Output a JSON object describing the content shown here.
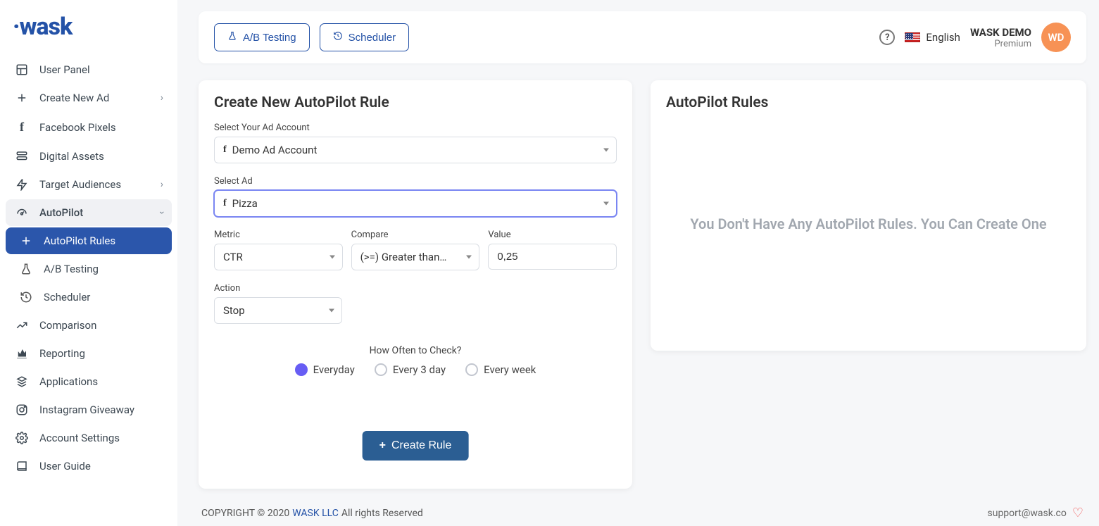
{
  "brand": "wask",
  "sidebar": {
    "items": [
      {
        "label": "User Panel"
      },
      {
        "label": "Create New Ad"
      },
      {
        "label": "Facebook Pixels"
      },
      {
        "label": "Digital Assets"
      },
      {
        "label": "Target Audiences"
      },
      {
        "label": "AutoPilot"
      },
      {
        "label": "AutoPilot Rules"
      },
      {
        "label": "A/B Testing"
      },
      {
        "label": "Scheduler"
      },
      {
        "label": "Comparison"
      },
      {
        "label": "Reporting"
      },
      {
        "label": "Applications"
      },
      {
        "label": "Instagram Giveaway"
      },
      {
        "label": "Account Settings"
      },
      {
        "label": "User Guide"
      }
    ]
  },
  "topbar": {
    "ab_btn": "A/B Testing",
    "scheduler_btn": "Scheduler",
    "language": "English",
    "user_name": "WASK DEMO",
    "user_plan": "Premium",
    "avatar_initials": "WD"
  },
  "form": {
    "title": "Create New AutoPilot Rule",
    "ad_account_label": "Select Your Ad Account",
    "ad_account_value": "Demo Ad Account",
    "select_ad_label": "Select Ad",
    "select_ad_value": "Pizza",
    "metric_label": "Metric",
    "metric_value": "CTR",
    "compare_label": "Compare",
    "compare_value": "(>=) Greater than ...",
    "value_label": "Value",
    "value_value": "0,25",
    "action_label": "Action",
    "action_value": "Stop",
    "how_often_label": "How Often to Check?",
    "radio_everyday": "Everyday",
    "radio_every3": "Every 3 day",
    "radio_everyweek": "Every week",
    "create_btn": "Create Rule"
  },
  "rules_panel": {
    "title": "AutoPilot Rules",
    "empty": "You Don't Have Any AutoPilot Rules. You Can Create One"
  },
  "footer": {
    "copyright_prefix": "COPYRIGHT © 2020 ",
    "company": "WASK LLC",
    "copyright_suffix": " All rights Reserved",
    "support": "support@wask.co"
  }
}
